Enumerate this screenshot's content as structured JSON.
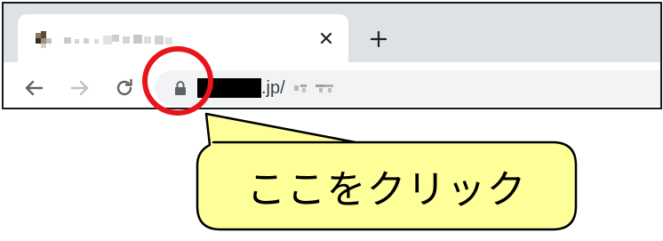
{
  "browser": {
    "tab": {
      "title_redacted": true,
      "close_icon": "close-icon",
      "favicon_redacted": true
    },
    "new_tab_icon": "plus-icon",
    "toolbar": {
      "back_icon": "arrow-left-icon",
      "forward_icon": "arrow-right-icon",
      "reload_icon": "reload-icon",
      "omnibox": {
        "lock_icon": "lock-icon",
        "url_suffix": ".jp/"
      }
    }
  },
  "annotation": {
    "callout_text": "ここをクリック",
    "highlight_color": "#e8141b",
    "callout_fill": "#ffff99",
    "callout_border": "#000000"
  }
}
